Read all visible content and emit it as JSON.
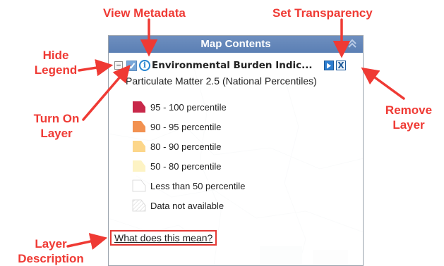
{
  "annotations": {
    "view_metadata": "View Metadata",
    "set_transparency": "Set Transparency",
    "hide_legend_line1": "Hide",
    "hide_legend_line2": "Legend",
    "turn_on_layer_line1": "Turn On",
    "turn_on_layer_line2": "Layer",
    "remove_layer_line1": "Remove",
    "remove_layer_line2": "Layer",
    "layer_description_line1": "Layer",
    "layer_description_line2": "Description"
  },
  "panel": {
    "title": "Map Contents",
    "collapse_icon": "double-chevron-up-icon",
    "layer": {
      "hide_legend_symbol": "−",
      "checked": true,
      "info_symbol": "i",
      "name": "Environmental Burden Indic...",
      "remove_symbol": "X"
    },
    "legend_title": "Particulate Matter 2.5 (National Percentiles)",
    "legend_items": [
      {
        "label": "95 - 100 percentile",
        "color": "#c8284a"
      },
      {
        "label": "90 - 95 percentile",
        "color": "#f29150"
      },
      {
        "label": "80 - 90 percentile",
        "color": "#fcd68a"
      },
      {
        "label": "50 - 80 percentile",
        "color": "#fdf3c4"
      },
      {
        "label": "Less than 50 percentile",
        "color": "#ffffff"
      },
      {
        "label": "Data not available",
        "color": "hatched"
      }
    ],
    "help_link": "What does this mean?"
  },
  "colors": {
    "annotation": "#ef3a34",
    "header": "#5f82b6"
  }
}
